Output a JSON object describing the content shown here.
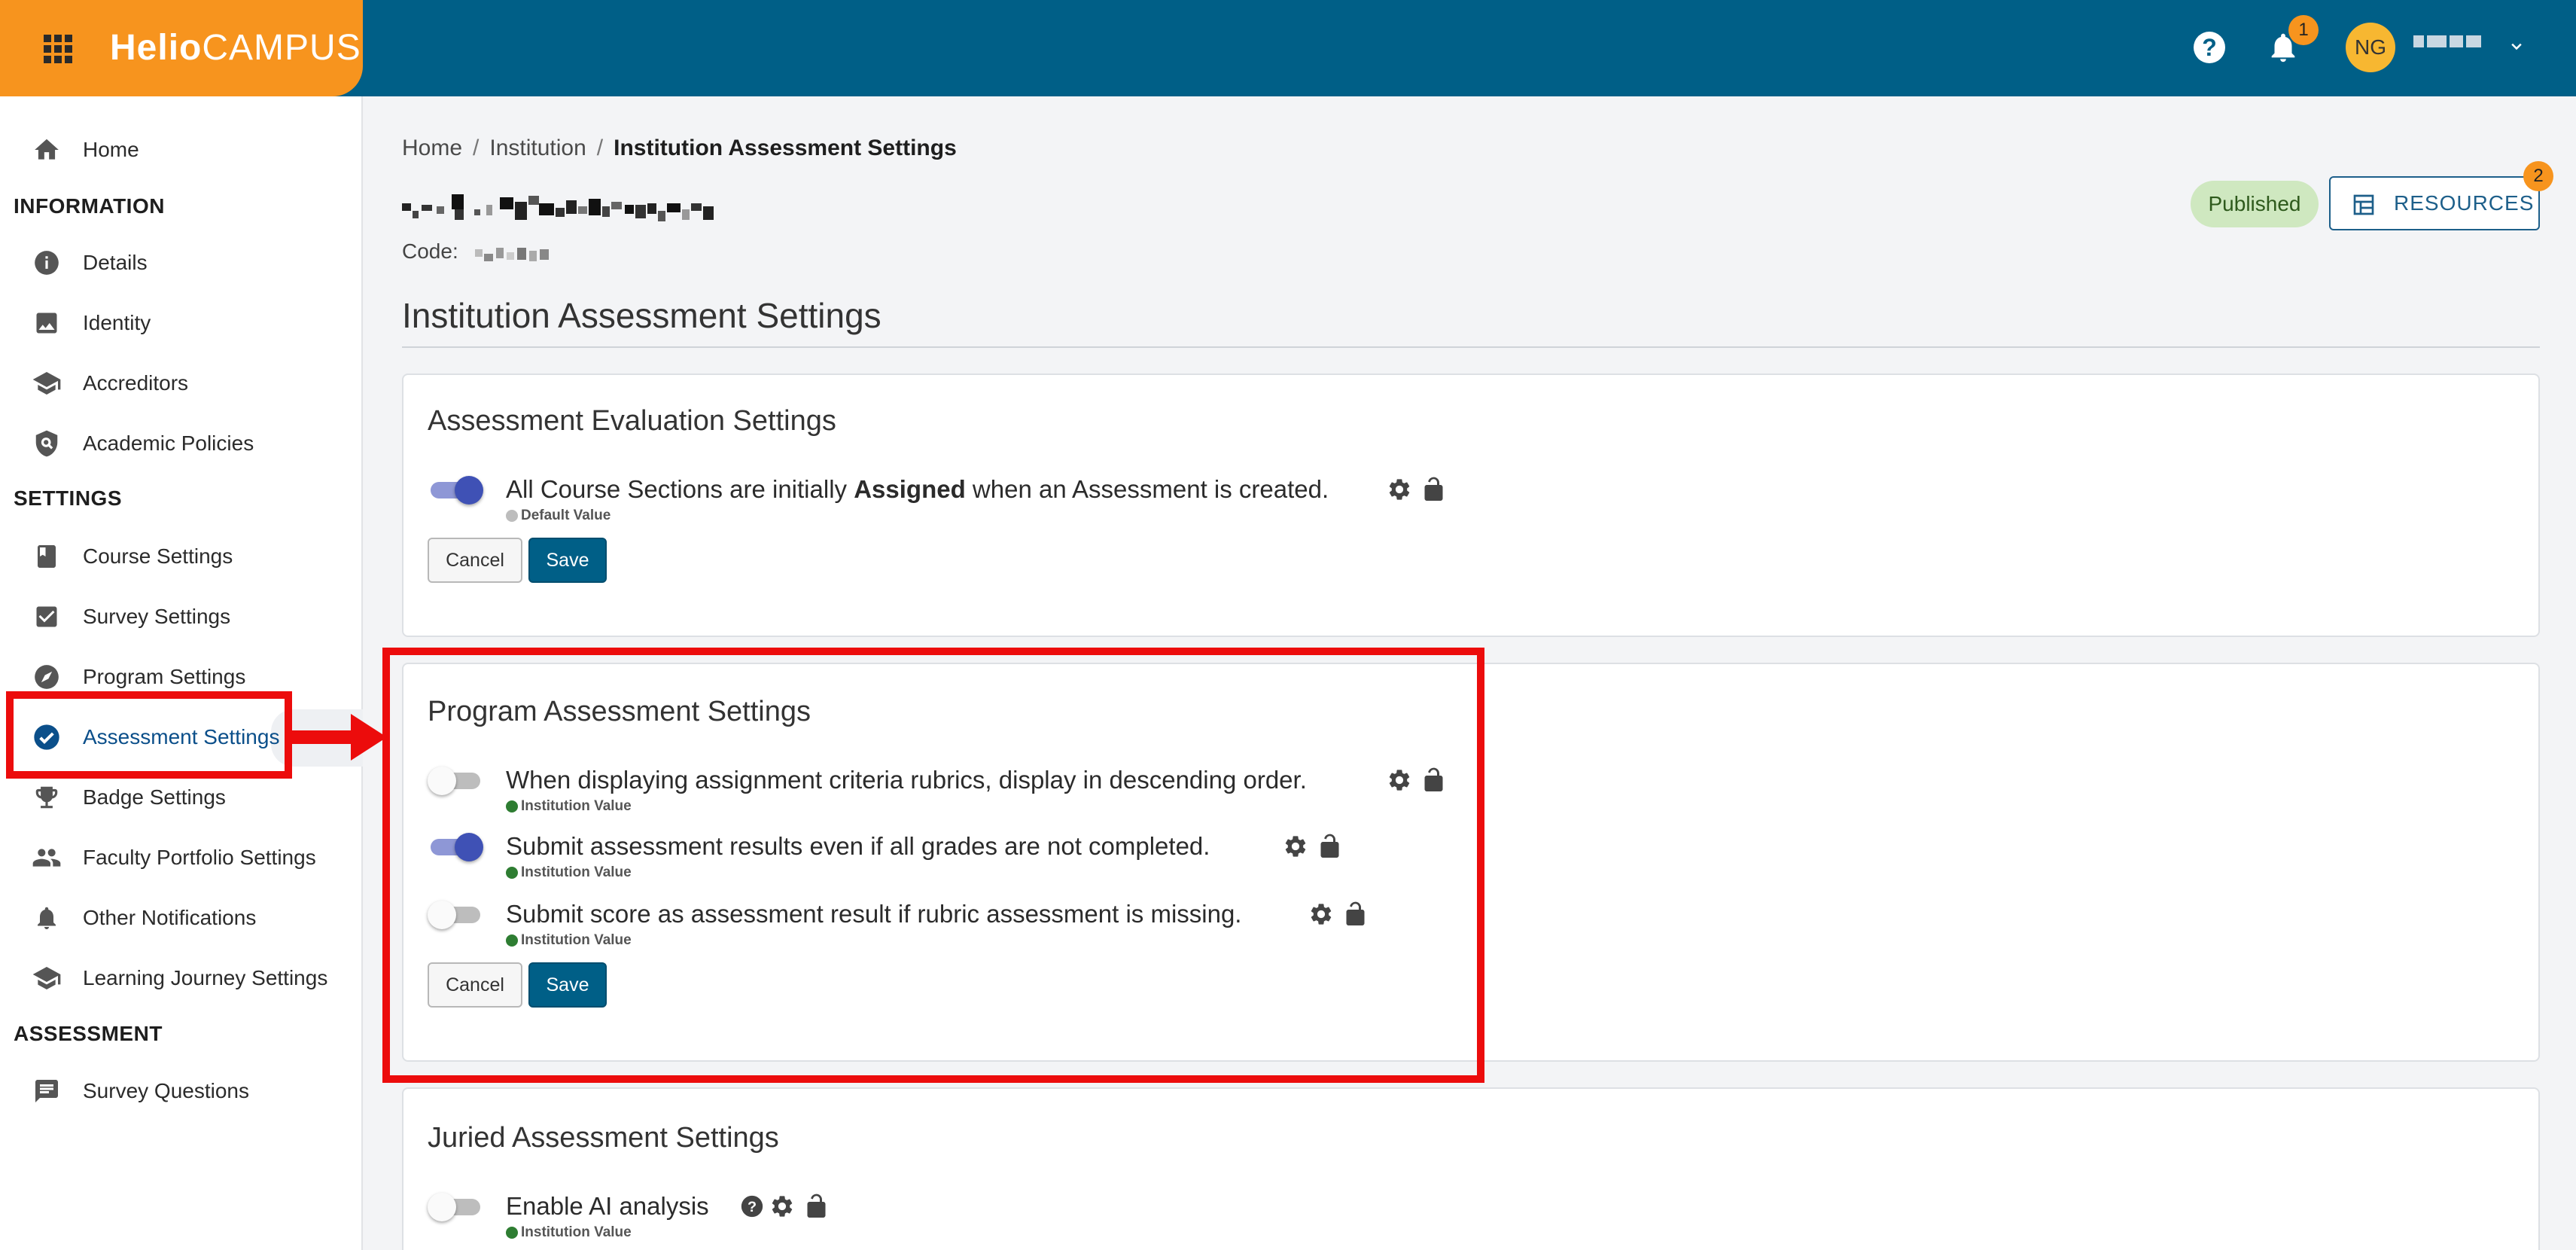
{
  "header": {
    "logo_bold": "Helio",
    "logo_thin": "CAMPUS",
    "help_label": "?",
    "notification_count": "1",
    "avatar_initials": "NG"
  },
  "sidebar": {
    "home": "Home",
    "sections": {
      "information": "INFORMATION",
      "settings": "SETTINGS",
      "assessment": "ASSESSMENT"
    },
    "information_items": [
      "Details",
      "Identity",
      "Accreditors",
      "Academic Policies"
    ],
    "settings_items": [
      "Course Settings",
      "Survey Settings",
      "Program Settings",
      "Assessment Settings",
      "Badge Settings",
      "Faculty Portfolio Settings",
      "Other Notifications",
      "Learning Journey Settings"
    ],
    "assessment_items": [
      "Survey Questions"
    ],
    "active_item": "Assessment Settings"
  },
  "breadcrumb": [
    "Home",
    "Institution",
    "Institution Assessment Settings"
  ],
  "institution": {
    "code_label": "Code:"
  },
  "status_badge": "Published",
  "resources": {
    "label": "RESOURCES",
    "badge_count": "2"
  },
  "page_title": "Institution Assessment Settings",
  "cards": {
    "evaluation": {
      "title": "Assessment Evaluation Settings",
      "rows": [
        {
          "text_pre": "All Course Sections are initially ",
          "text_bold": "Assigned",
          "text_post": " when an Assessment is created.",
          "enabled": true,
          "value_source": "Default Value"
        }
      ],
      "cancel": "Cancel",
      "save": "Save"
    },
    "program": {
      "title": "Program Assessment Settings",
      "rows": [
        {
          "text": "When displaying assignment criteria rubrics, display in descending order.",
          "enabled": false,
          "value_source": "Institution Value"
        },
        {
          "text": "Submit assessment results even if all grades are not completed.",
          "enabled": true,
          "value_source": "Institution Value"
        },
        {
          "text": "Submit score as assessment result if rubric assessment is missing.",
          "enabled": false,
          "value_source": "Institution Value"
        }
      ],
      "cancel": "Cancel",
      "save": "Save"
    },
    "juried": {
      "title": "Juried Assessment Settings",
      "rows": [
        {
          "text": "Enable AI analysis",
          "enabled": false,
          "value_source": "Institution Value"
        }
      ]
    }
  },
  "colors": {
    "brand_orange": "#f7941e",
    "header_blue": "#005f87",
    "toggle_on": "#3f51b5",
    "annotation_red": "#ec0c0c",
    "published_bg": "#cfe8c0"
  }
}
